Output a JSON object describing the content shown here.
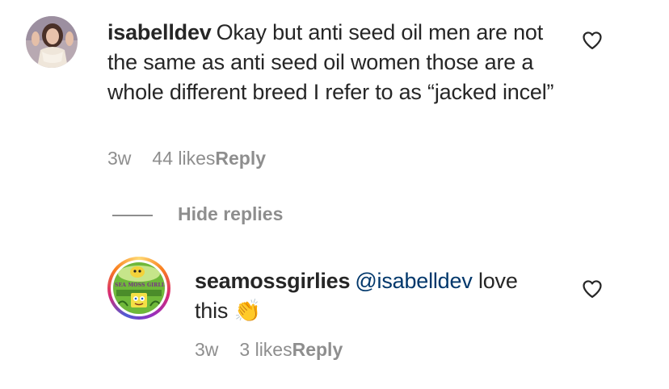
{
  "comment": {
    "username": "isabelldev",
    "text": "Okay but anti seed oil men are not the same as anti seed oil women those are a whole different breed I refer to as “jacked incel”",
    "time": "3w",
    "likes": "44 likes",
    "reply_label": "Reply",
    "avatar_icon": "profile-photo"
  },
  "replies_toggle": {
    "label": "Hide replies"
  },
  "reply": {
    "username": "seamossgirlies",
    "mention": "@isabelldev",
    "text": "love this",
    "emoji": "👏",
    "time": "3w",
    "likes": "3 likes",
    "reply_label": "Reply",
    "avatar_text": "SEA MOSS GIRLIES",
    "avatar_icon": "sponge-cartoon-logo"
  },
  "colors": {
    "text": "#262626",
    "secondary": "#8e8e8e",
    "mention": "#00376b",
    "story_ring": [
      "#feda75",
      "#fa7e1e",
      "#d62976",
      "#962fbf",
      "#4f5bd5"
    ]
  }
}
